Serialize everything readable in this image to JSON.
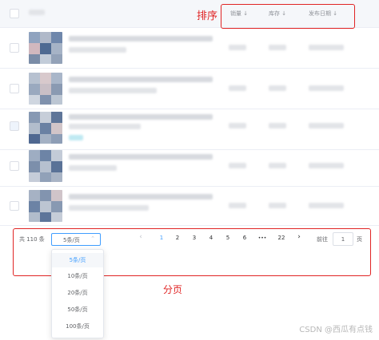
{
  "table": {
    "columns": {
      "sales": "销量 ↓",
      "stock": "库存 ↓",
      "publish_date": "发布日期 ↓"
    }
  },
  "annotations": {
    "sort": "排序",
    "pagination": "分页"
  },
  "pagination": {
    "total": "共 110 条",
    "page_size": "5条/页",
    "page_size_caret": "⌃",
    "prev": "‹",
    "pages": [
      "1",
      "2",
      "3",
      "4",
      "5",
      "6",
      "•••",
      "22"
    ],
    "next": "›",
    "goto_label": "前往",
    "goto_value": "1",
    "goto_suffix": "页",
    "page_size_options": [
      "5条/页",
      "10条/页",
      "20条/页",
      "50条/页",
      "100条/页"
    ]
  },
  "watermark": "CSDN @西瓜有点钱",
  "colors": {
    "accent": "#409eff",
    "annotation_red": "#e02424"
  }
}
